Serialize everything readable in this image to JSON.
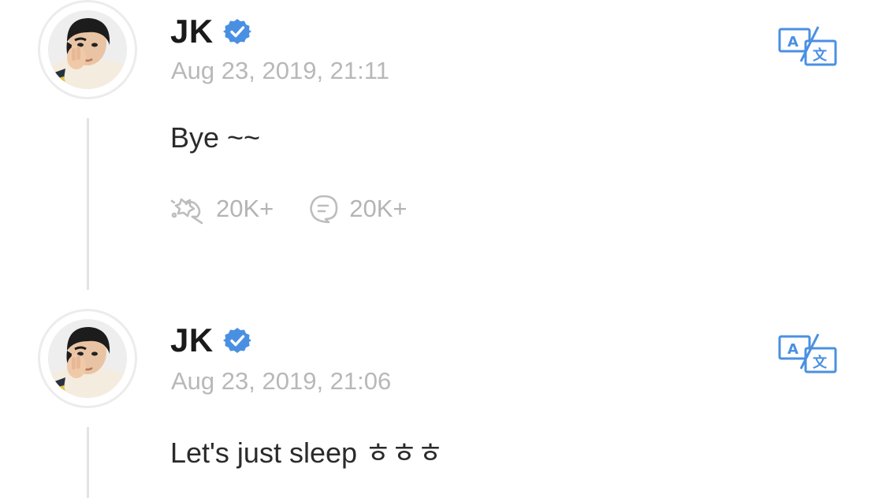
{
  "posts": [
    {
      "author": "JK",
      "timestamp": "Aug 23, 2019, 21:11",
      "text": "Bye ~~",
      "likes": "20K+",
      "comments": "20K+"
    },
    {
      "author": "JK",
      "timestamp": "Aug 23, 2019, 21:06",
      "text": "Let's just sleep ㅎㅎㅎ"
    }
  ],
  "icons": {
    "verified": "verified-badge-icon",
    "translate": "translate-icon",
    "like": "cheer-icon",
    "comment": "comment-bubble-icon"
  },
  "colors": {
    "accent": "#4a90e2",
    "muted": "#b8b8b8",
    "text": "#2b2b2b"
  }
}
